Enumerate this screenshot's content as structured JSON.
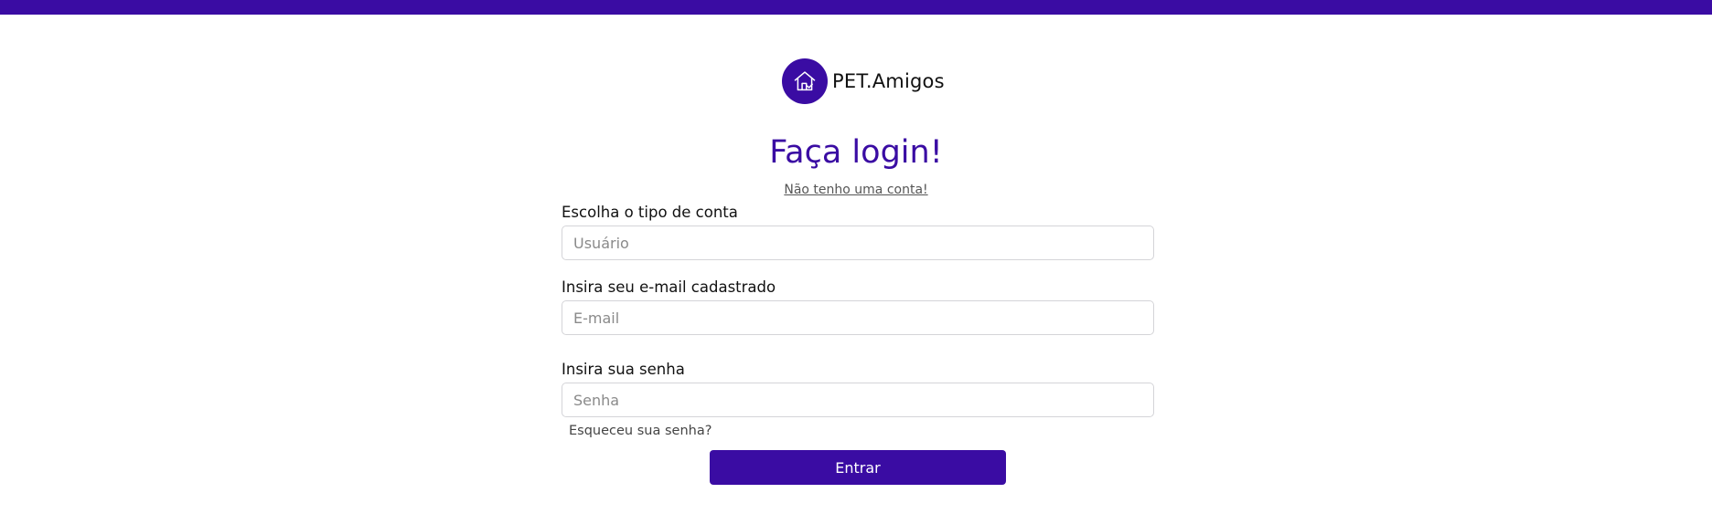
{
  "brand": {
    "name": "PET.Amigos",
    "logo_icon": "house-icon",
    "color": "#3a0ca3"
  },
  "header": {
    "bar_color": "#3a0ca3"
  },
  "login": {
    "title": "Faça login!",
    "signup_link": "Não tenho uma conta!",
    "account_type": {
      "label": "Escolha o tipo de conta",
      "placeholder": "Usuário",
      "value": ""
    },
    "email": {
      "label": "Insira seu e-mail cadastrado",
      "placeholder": "E-mail",
      "value": ""
    },
    "password": {
      "label": "Insira sua senha",
      "placeholder": "Senha",
      "value": ""
    },
    "forgot_password": "Esqueceu sua senha?",
    "submit_label": "Entrar"
  }
}
